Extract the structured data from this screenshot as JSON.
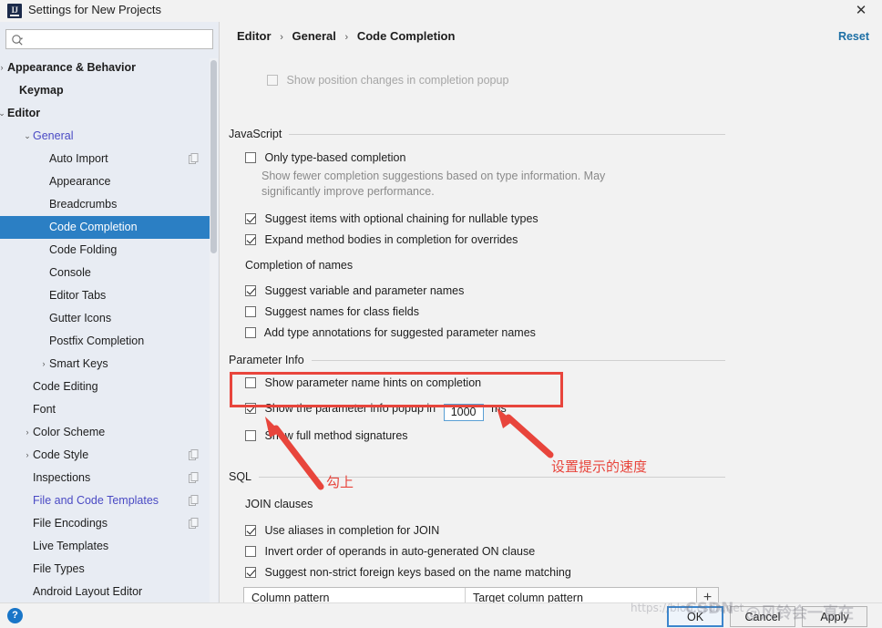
{
  "window": {
    "title": "Settings for New Projects",
    "app_icon": "intellij-idea-icon",
    "close_label": "✕"
  },
  "search": {
    "placeholder": "",
    "value": "",
    "icon": "search-icon"
  },
  "sidebar": {
    "items": [
      {
        "label": "Appearance & Behavior",
        "indent": 8,
        "arrow": "›",
        "bold": true,
        "selected": false,
        "link": false,
        "copy": false
      },
      {
        "label": "Keymap",
        "indent": 21,
        "arrow": "",
        "bold": true,
        "selected": false,
        "link": false,
        "copy": false
      },
      {
        "label": "Editor",
        "indent": 8,
        "arrow": "⌄",
        "bold": true,
        "selected": false,
        "link": false,
        "copy": false
      },
      {
        "label": "General",
        "indent": 36,
        "arrow": "⌄",
        "bold": false,
        "selected": false,
        "link": true,
        "copy": false
      },
      {
        "label": "Auto Import",
        "indent": 54,
        "arrow": "",
        "bold": false,
        "selected": false,
        "link": false,
        "copy": true
      },
      {
        "label": "Appearance",
        "indent": 54,
        "arrow": "",
        "bold": false,
        "selected": false,
        "link": false,
        "copy": false
      },
      {
        "label": "Breadcrumbs",
        "indent": 54,
        "arrow": "",
        "bold": false,
        "selected": false,
        "link": false,
        "copy": false
      },
      {
        "label": "Code Completion",
        "indent": 54,
        "arrow": "",
        "bold": false,
        "selected": true,
        "link": false,
        "copy": false
      },
      {
        "label": "Code Folding",
        "indent": 54,
        "arrow": "",
        "bold": false,
        "selected": false,
        "link": false,
        "copy": false
      },
      {
        "label": "Console",
        "indent": 54,
        "arrow": "",
        "bold": false,
        "selected": false,
        "link": false,
        "copy": false
      },
      {
        "label": "Editor Tabs",
        "indent": 54,
        "arrow": "",
        "bold": false,
        "selected": false,
        "link": false,
        "copy": false
      },
      {
        "label": "Gutter Icons",
        "indent": 54,
        "arrow": "",
        "bold": false,
        "selected": false,
        "link": false,
        "copy": false
      },
      {
        "label": "Postfix Completion",
        "indent": 54,
        "arrow": "",
        "bold": false,
        "selected": false,
        "link": false,
        "copy": false
      },
      {
        "label": "Smart Keys",
        "indent": 54,
        "arrow": "›",
        "bold": false,
        "selected": false,
        "link": false,
        "copy": false
      },
      {
        "label": "Code Editing",
        "indent": 36,
        "arrow": "",
        "bold": false,
        "selected": false,
        "link": false,
        "copy": false
      },
      {
        "label": "Font",
        "indent": 36,
        "arrow": "",
        "bold": false,
        "selected": false,
        "link": false,
        "copy": false
      },
      {
        "label": "Color Scheme",
        "indent": 36,
        "arrow": "›",
        "bold": false,
        "selected": false,
        "link": false,
        "copy": false
      },
      {
        "label": "Code Style",
        "indent": 36,
        "arrow": "›",
        "bold": false,
        "selected": false,
        "link": false,
        "copy": true
      },
      {
        "label": "Inspections",
        "indent": 36,
        "arrow": "",
        "bold": false,
        "selected": false,
        "link": false,
        "copy": true
      },
      {
        "label": "File and Code Templates",
        "indent": 36,
        "arrow": "",
        "bold": false,
        "selected": false,
        "link": true,
        "copy": true
      },
      {
        "label": "File Encodings",
        "indent": 36,
        "arrow": "",
        "bold": false,
        "selected": false,
        "link": false,
        "copy": true
      },
      {
        "label": "Live Templates",
        "indent": 36,
        "arrow": "",
        "bold": false,
        "selected": false,
        "link": false,
        "copy": false
      },
      {
        "label": "File Types",
        "indent": 36,
        "arrow": "",
        "bold": false,
        "selected": false,
        "link": false,
        "copy": false
      },
      {
        "label": "Android Layout Editor",
        "indent": 36,
        "arrow": "",
        "bold": false,
        "selected": false,
        "link": false,
        "copy": false
      }
    ]
  },
  "breadcrumb": {
    "part1": "Editor",
    "sep1": "›",
    "part2": "General",
    "sep2": "›",
    "part3": "Code Completion"
  },
  "reset_label": "Reset",
  "main": {
    "top_disabled_option": "Show position changes in completion popup",
    "sections": {
      "javascript": {
        "title": "JavaScript",
        "only_type_based": "Only type-based completion",
        "only_type_based_desc": "Show fewer completion suggestions based on type information. May significantly improve performance.",
        "optional_chaining": "Suggest items with optional chaining for nullable types",
        "expand_method_bodies": "Expand method bodies in completion for overrides",
        "completion_of_names": "Completion of names",
        "suggest_var_param": "Suggest variable and parameter names",
        "suggest_class_fields": "Suggest names for class fields",
        "add_type_annotations": "Add type annotations for suggested parameter names"
      },
      "parameter_info": {
        "title": "Parameter Info",
        "show_hints": "Show parameter name hints on completion",
        "popup_prefix": "Show the parameter info popup in",
        "popup_delay_value": "1000",
        "popup_suffix": "ms",
        "full_signatures": "Show full method signatures"
      },
      "sql": {
        "title": "SQL",
        "join_clauses": "JOIN clauses",
        "use_aliases": "Use aliases in completion for JOIN",
        "invert_order": "Invert order of operands in auto-generated ON clause",
        "suggest_fk": "Suggest non-strict foreign keys based on the name matching",
        "table": {
          "columns": [
            "Column pattern",
            "Target column pattern"
          ],
          "rows": [
            [
              "",
              ""
            ]
          ],
          "add_label": "+"
        }
      }
    }
  },
  "footer": {
    "help_label": "?",
    "ok": "OK",
    "cancel": "Cancel",
    "apply": "Apply"
  },
  "annotations": {
    "note_check_it": "勾上",
    "note_set_speed": "设置提示的速度",
    "highlight_color": "#e8453c"
  },
  "watermark": {
    "url": "https://blog.csdn.net",
    "csdn": "CSDN",
    "user": "@风铃会一直在"
  }
}
